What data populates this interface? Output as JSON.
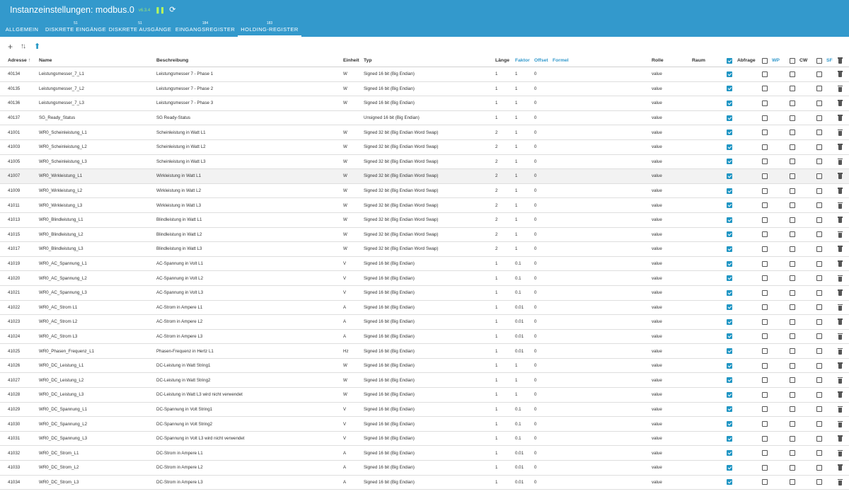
{
  "header": {
    "title": "Instanzeinstellungen: modbus.0",
    "version": "v6.3.4",
    "tabs": [
      {
        "count": "",
        "label": "ALLGEMEIN"
      },
      {
        "count": "51",
        "label": "DISKRETE EINGÄNGE"
      },
      {
        "count": "51",
        "label": "DISKRETE AUSGÄNGE"
      },
      {
        "count": "184",
        "label": "EINGANGSREGISTER"
      },
      {
        "count": "183",
        "label": "HOLDING-REGISTER"
      }
    ],
    "active_tab": "HOLDING-REGISTER",
    "colors": {
      "bar": "#3399cc",
      "accent": "#2196c4"
    }
  },
  "toolbar": {
    "icons": [
      "plus-icon",
      "sort-icon",
      "upload-icon"
    ]
  },
  "table": {
    "columns": {
      "adresse": "Adresse",
      "name": "Name",
      "beschreibung": "Beschreibung",
      "einheit": "Einheit",
      "typ": "Typ",
      "laenge": "Länge",
      "faktor": "Faktor",
      "offset": "Offset",
      "formel": "Formel",
      "rolle": "Rolle",
      "raum": "Raum",
      "abfrage": "Abfrage",
      "wp": "WP",
      "cw": "CW",
      "sf": "SF"
    },
    "sort_indicator": "↑",
    "rows": [
      {
        "adr": "40134",
        "name": "Leistungsmesser_7_L1",
        "desc": "Leistungsmesser 7 - Phase 1",
        "unit": "W",
        "typ": "Signed 16 bit (Big Endian)",
        "len": "1",
        "fak": "1",
        "off": "0",
        "role": "value"
      },
      {
        "adr": "40135",
        "name": "Leistungsmesser_7_L2",
        "desc": "Leistungsmesser 7 - Phase 2",
        "unit": "W",
        "typ": "Signed 16 bit (Big Endian)",
        "len": "1",
        "fak": "1",
        "off": "0",
        "role": "value"
      },
      {
        "adr": "40136",
        "name": "Leistungsmesser_7_L3",
        "desc": "Leistungsmesser 7 - Phase 3",
        "unit": "W",
        "typ": "Signed 16 bit (Big Endian)",
        "len": "1",
        "fak": "1",
        "off": "0",
        "role": "value"
      },
      {
        "adr": "40137",
        "name": "SG_Ready_Status",
        "desc": "SG Ready-Status",
        "unit": "",
        "typ": "Unsigned 16 bit (Big Endian)",
        "len": "1",
        "fak": "1",
        "off": "0",
        "role": "value"
      },
      {
        "adr": "41001",
        "name": "WR0_Scheinleistung_L1",
        "desc": "Scheinleistung in Watt L1",
        "unit": "W",
        "typ": "Signed 32 bit (Big Endian Word Swap)",
        "len": "2",
        "fak": "1",
        "off": "0",
        "role": "value"
      },
      {
        "adr": "41003",
        "name": "WR0_Scheinleistung_L2",
        "desc": "Scheinleistung in Watt L2",
        "unit": "W",
        "typ": "Signed 32 bit (Big Endian Word Swap)",
        "len": "2",
        "fak": "1",
        "off": "0",
        "role": "value"
      },
      {
        "adr": "41005",
        "name": "WR0_Scheinleistung_L3",
        "desc": "Scheinleistung in Watt L3",
        "unit": "W",
        "typ": "Signed 32 bit (Big Endian Word Swap)",
        "len": "2",
        "fak": "1",
        "off": "0",
        "role": "value"
      },
      {
        "adr": "41007",
        "name": "WR0_Wirkleistung_L1",
        "desc": "Wirkleistung in Watt L1",
        "unit": "W",
        "typ": "Signed 32 bit (Big Endian Word Swap)",
        "len": "2",
        "fak": "1",
        "off": "0",
        "role": "value"
      },
      {
        "adr": "41009",
        "name": "WR0_Wirkleistung_L2",
        "desc": "Wirkleistung in Watt L2",
        "unit": "W",
        "typ": "Signed 32 bit (Big Endian Word Swap)",
        "len": "2",
        "fak": "1",
        "off": "0",
        "role": "value"
      },
      {
        "adr": "41011",
        "name": "WR0_Wirkleistung_L3",
        "desc": "Wirkleistung in Watt L3",
        "unit": "W",
        "typ": "Signed 32 bit (Big Endian Word Swap)",
        "len": "2",
        "fak": "1",
        "off": "0",
        "role": "value"
      },
      {
        "adr": "41013",
        "name": "WR0_Blindleistung_L1",
        "desc": "Blindleistung in Watt L1",
        "unit": "W",
        "typ": "Signed 32 bit (Big Endian Word Swap)",
        "len": "2",
        "fak": "1",
        "off": "0",
        "role": "value"
      },
      {
        "adr": "41015",
        "name": "WR0_Blindleistung_L2",
        "desc": "Blindleistung in Watt L2",
        "unit": "W",
        "typ": "Signed 32 bit (Big Endian Word Swap)",
        "len": "2",
        "fak": "1",
        "off": "0",
        "role": "value"
      },
      {
        "adr": "41017",
        "name": "WR0_Blindleistung_L3",
        "desc": "Blindleistung in Watt L3",
        "unit": "W",
        "typ": "Signed 32 bit (Big Endian Word Swap)",
        "len": "2",
        "fak": "1",
        "off": "0",
        "role": "value"
      },
      {
        "adr": "41019",
        "name": "WR0_AC_Spannung_L1",
        "desc": "AC-Spannung in Volt L1",
        "unit": "V",
        "typ": "Signed 16 bit (Big Endian)",
        "len": "1",
        "fak": "0.1",
        "off": "0",
        "role": "value"
      },
      {
        "adr": "41020",
        "name": "WR0_AC_Spannung_L2",
        "desc": "AC-Spannung in Volt L2",
        "unit": "V",
        "typ": "Signed 16 bit (Big Endian)",
        "len": "1",
        "fak": "0.1",
        "off": "0",
        "role": "value"
      },
      {
        "adr": "41021",
        "name": "WR0_AC_Spannung_L3",
        "desc": "AC-Spannung in Volt L3",
        "unit": "V",
        "typ": "Signed 16 bit (Big Endian)",
        "len": "1",
        "fak": "0.1",
        "off": "0",
        "role": "value"
      },
      {
        "adr": "41022",
        "name": "WR0_AC_Strom L1",
        "desc": "AC-Strom in Ampere L1",
        "unit": "A",
        "typ": "Signed 16 bit (Big Endian)",
        "len": "1",
        "fak": "0.01",
        "off": "0",
        "role": "value"
      },
      {
        "adr": "41023",
        "name": "WR0_AC_Strom L2",
        "desc": "AC-Strom in Ampere L2",
        "unit": "A",
        "typ": "Signed 16 bit (Big Endian)",
        "len": "1",
        "fak": "0.01",
        "off": "0",
        "role": "value"
      },
      {
        "adr": "41024",
        "name": "WR0_AC_Strom L3",
        "desc": "AC-Strom in Ampere L3",
        "unit": "A",
        "typ": "Signed 16 bit (Big Endian)",
        "len": "1",
        "fak": "0.01",
        "off": "0",
        "role": "value"
      },
      {
        "adr": "41025",
        "name": "WR0_Phasen_Frequenz_L1",
        "desc": "Phasen-Frequenz in Hertz L1",
        "unit": "Hz",
        "typ": "Signed 16 bit (Big Endian)",
        "len": "1",
        "fak": "0.01",
        "off": "0",
        "role": "value"
      },
      {
        "adr": "41026",
        "name": "WR0_DC_Leistung_L1",
        "desc": "DC-Leistung in Watt String1",
        "unit": "W",
        "typ": "Signed 16 bit (Big Endian)",
        "len": "1",
        "fak": "1",
        "off": "0",
        "role": "value"
      },
      {
        "adr": "41027",
        "name": "WR0_DC_Leistung_L2",
        "desc": "DC-Leistung in Watt String2",
        "unit": "W",
        "typ": "Signed 16 bit (Big Endian)",
        "len": "1",
        "fak": "1",
        "off": "0",
        "role": "value"
      },
      {
        "adr": "41028",
        "name": "WR0_DC_Leistung_L3",
        "desc": "DC-Leistung in Watt L3 wird nicht verwendet",
        "unit": "W",
        "typ": "Signed 16 bit (Big Endian)",
        "len": "1",
        "fak": "1",
        "off": "0",
        "role": "value"
      },
      {
        "adr": "41029",
        "name": "WR0_DC_Spannung_L1",
        "desc": "DC-Spannung in Volt String1",
        "unit": "V",
        "typ": "Signed 16 bit (Big Endian)",
        "len": "1",
        "fak": "0.1",
        "off": "0",
        "role": "value"
      },
      {
        "adr": "41030",
        "name": "WR0_DC_Spannung_L2",
        "desc": "DC-Spannung in Volt String2",
        "unit": "V",
        "typ": "Signed 16 bit (Big Endian)",
        "len": "1",
        "fak": "0.1",
        "off": "0",
        "role": "value"
      },
      {
        "adr": "41031",
        "name": "WR0_DC_Spannung_L3",
        "desc": "DC-Spannung in Volt L3 wird nicht verwendet",
        "unit": "V",
        "typ": "Signed 16 bit (Big Endian)",
        "len": "1",
        "fak": "0.1",
        "off": "0",
        "role": "value"
      },
      {
        "adr": "41032",
        "name": "WR0_DC_Strom_L1",
        "desc": "DC-Strom in Ampere L1",
        "unit": "A",
        "typ": "Signed 16 bit (Big Endian)",
        "len": "1",
        "fak": "0.01",
        "off": "0",
        "role": "value"
      },
      {
        "adr": "41033",
        "name": "WR0_DC_Strom_L2",
        "desc": "DC-Strom in Ampere L2",
        "unit": "A",
        "typ": "Signed 16 bit (Big Endian)",
        "len": "1",
        "fak": "0.01",
        "off": "0",
        "role": "value"
      },
      {
        "adr": "41034",
        "name": "WR0_DC_Strom_L3",
        "desc": "DC-Strom in Ampere L3",
        "unit": "A",
        "typ": "Signed 16 bit (Big Endian)",
        "len": "1",
        "fak": "0.01",
        "off": "0",
        "role": "value"
      }
    ]
  }
}
